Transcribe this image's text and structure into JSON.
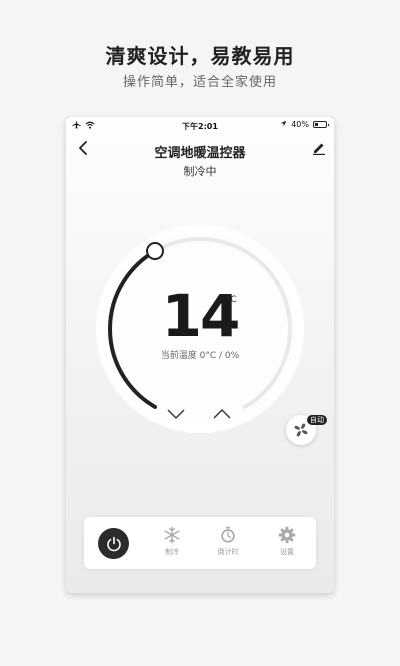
{
  "promo": {
    "title": "清爽设计，易教易用",
    "subtitle": "操作简单，适合全家使用"
  },
  "status_bar": {
    "time": "下午2:01",
    "battery": "40%",
    "battery_level": 0.4
  },
  "nav": {
    "title": "空调地暖温控器"
  },
  "mode_status": "制冷中",
  "thermostat": {
    "set_temp": "14",
    "unit": "°C",
    "current": "当前温度 0°C / 0%",
    "dial_fraction": 0.4
  },
  "fan": {
    "badge": "自动"
  },
  "controls": [
    {
      "label": "制冷"
    },
    {
      "label": "倒计时"
    },
    {
      "label": "设置"
    }
  ],
  "colors": {
    "accent": "#222222",
    "track": "#e9e9e9",
    "inactive": "#bbbbbb"
  }
}
